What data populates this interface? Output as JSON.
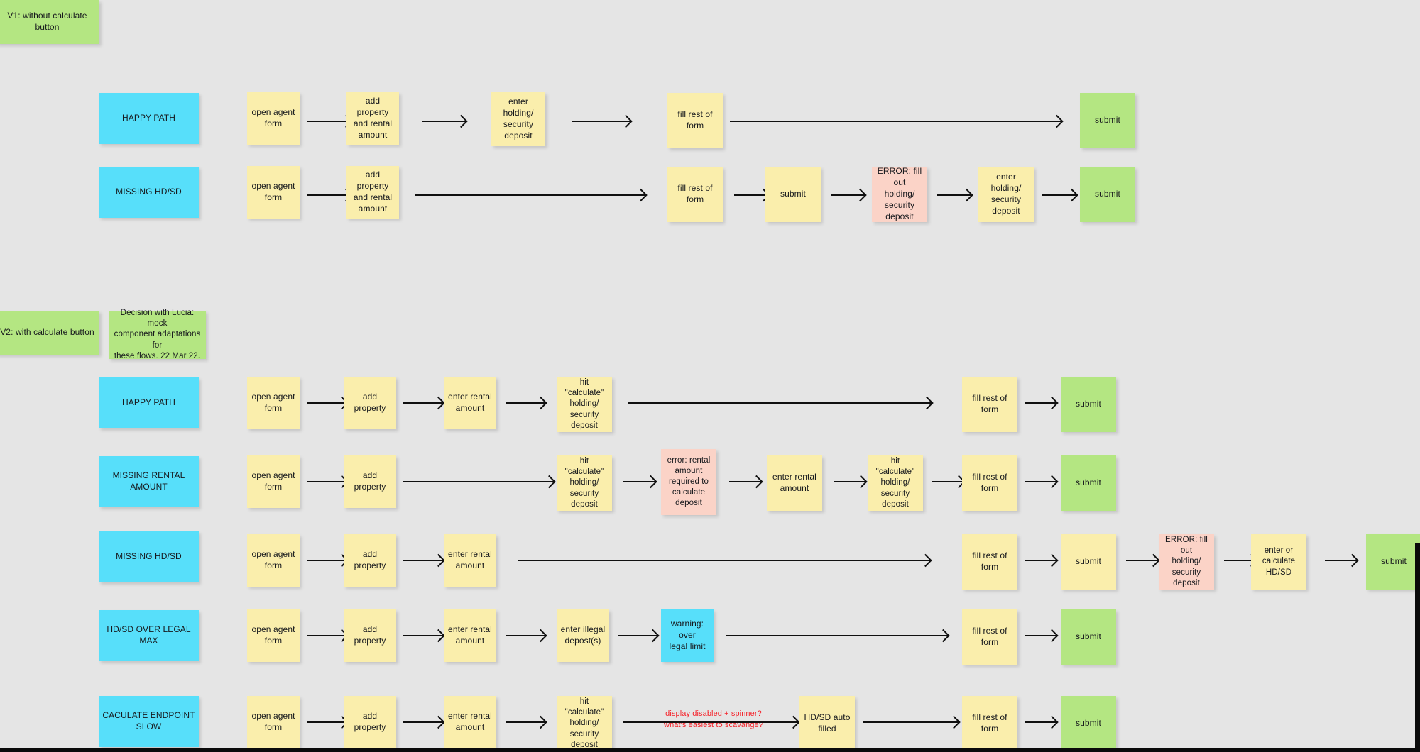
{
  "board": {
    "background_color": "#e5e5e5",
    "note_colors": {
      "yellow": "#faeeac",
      "green": "#b4e682",
      "cyan": "#57dffa",
      "pink": "#fbd3c7",
      "red_text": "#f5232b"
    }
  },
  "sections": [
    {
      "id": "v1",
      "label": "V1: without calculate button",
      "color": "green"
    },
    {
      "id": "v2",
      "label": "V2: with calculate button",
      "color": "green"
    }
  ],
  "decision_note": {
    "label": "Decision with Lucia: mock\ncomponent adaptations for\nthese flows. 22 Mar 22.",
    "color": "green"
  },
  "flows": [
    {
      "id": "v1-happy-path",
      "title": "HAPPY PATH",
      "steps": [
        {
          "label": "open agent\nform",
          "color": "yellow"
        },
        {
          "label": "add property\nand rental\namount",
          "color": "yellow"
        },
        {
          "label": "enter holding/\nsecurity deposit",
          "color": "yellow"
        },
        {
          "label": "fill rest of form",
          "color": "yellow"
        },
        {
          "label": "submit",
          "color": "green"
        }
      ]
    },
    {
      "id": "v1-missing-hd-sd",
      "title": "MISSING HD/SD",
      "steps": [
        {
          "label": "open agent\nform",
          "color": "yellow"
        },
        {
          "label": "add property\nand rental\namount",
          "color": "yellow"
        },
        {
          "label": "fill rest of form",
          "color": "yellow"
        },
        {
          "label": "submit",
          "color": "yellow"
        },
        {
          "label": "ERROR: fill out\nholding/\nsecurity deposit",
          "color": "pink"
        },
        {
          "label": "enter holding/\nsecurity deposit",
          "color": "yellow"
        },
        {
          "label": "submit",
          "color": "green"
        }
      ]
    },
    {
      "id": "v2-happy-path",
      "title": "HAPPY PATH",
      "steps": [
        {
          "label": "open agent\nform",
          "color": "yellow"
        },
        {
          "label": "add property",
          "color": "yellow"
        },
        {
          "label": "enter rental\namount",
          "color": "yellow"
        },
        {
          "label": "hit \"calculate\"\nholding/\nsecurity deposit",
          "color": "yellow"
        },
        {
          "label": "fill rest of form",
          "color": "yellow"
        },
        {
          "label": "submit",
          "color": "green"
        }
      ]
    },
    {
      "id": "v2-missing-rental-amount",
      "title": "MISSING RENTAL AMOUNT",
      "steps": [
        {
          "label": "open agent\nform",
          "color": "yellow"
        },
        {
          "label": "add property",
          "color": "yellow"
        },
        {
          "label": "hit \"calculate\"\nholding/\nsecurity deposit",
          "color": "yellow"
        },
        {
          "label": "error: rental\namount\nrequired to\ncalculate\ndeposit",
          "color": "pink"
        },
        {
          "label": "enter rental\namount",
          "color": "yellow"
        },
        {
          "label": "hit \"calculate\"\nholding/\nsecurity deposit",
          "color": "yellow"
        },
        {
          "label": "fill rest of form",
          "color": "yellow"
        },
        {
          "label": "submit",
          "color": "green"
        }
      ]
    },
    {
      "id": "v2-missing-hd-sd",
      "title": "MISSING HD/SD",
      "steps": [
        {
          "label": "open agent\nform",
          "color": "yellow"
        },
        {
          "label": "add property",
          "color": "yellow"
        },
        {
          "label": "enter rental\namount",
          "color": "yellow"
        },
        {
          "label": "fill rest of form",
          "color": "yellow"
        },
        {
          "label": "submit",
          "color": "yellow"
        },
        {
          "label": "ERROR: fill out\nholding/\nsecurity deposit",
          "color": "pink"
        },
        {
          "label": "enter or\ncalculate HD/SD",
          "color": "yellow"
        },
        {
          "label": "submit",
          "color": "green"
        }
      ]
    },
    {
      "id": "v2-hd-sd-over-legal-max",
      "title": "HD/SD OVER LEGAL MAX",
      "steps": [
        {
          "label": "open agent\nform",
          "color": "yellow"
        },
        {
          "label": "add property",
          "color": "yellow"
        },
        {
          "label": "enter rental\namount",
          "color": "yellow"
        },
        {
          "label": "enter illegal\ndepost(s)",
          "color": "yellow"
        },
        {
          "label": "warning: over\nlegal limit",
          "color": "cyan"
        },
        {
          "label": "fill rest of form",
          "color": "yellow"
        },
        {
          "label": "submit",
          "color": "green"
        }
      ]
    },
    {
      "id": "v2-calculate-endpoint-slow",
      "title": "CACULATE ENDPOINT SLOW",
      "annotation": "display disabled + spinner?\nwhat's easiest to scavange?",
      "steps": [
        {
          "label": "open agent\nform",
          "color": "yellow"
        },
        {
          "label": "add property",
          "color": "yellow"
        },
        {
          "label": "enter rental\namount",
          "color": "yellow"
        },
        {
          "label": "hit \"calculate\"\nholding/\nsecurity deposit",
          "color": "yellow"
        },
        {
          "label": "HD/SD auto\nfilled",
          "color": "yellow"
        },
        {
          "label": "fill rest of form",
          "color": "yellow"
        },
        {
          "label": "submit",
          "color": "green"
        }
      ]
    }
  ]
}
